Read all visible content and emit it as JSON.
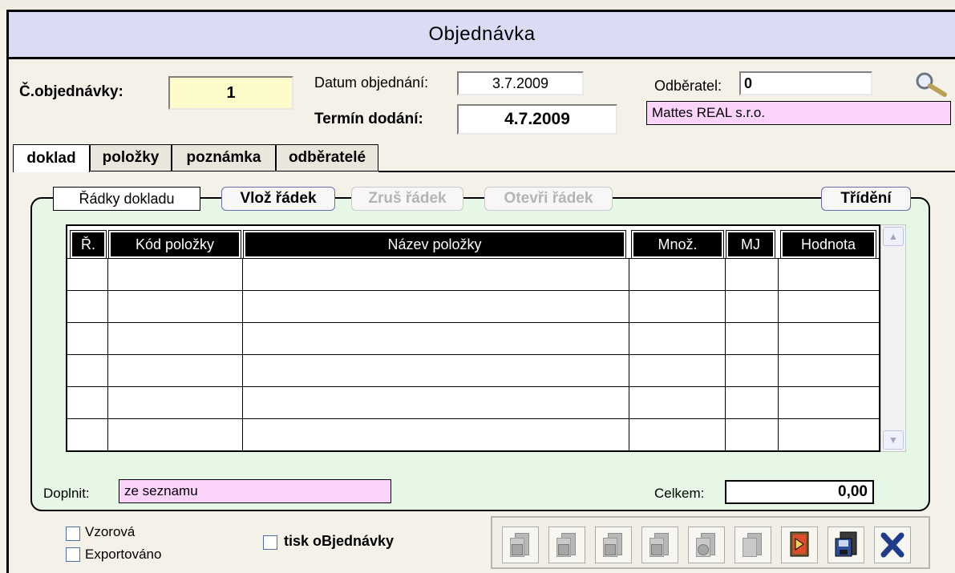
{
  "window": {
    "title": "Objednávka"
  },
  "header": {
    "order_no_label": "Č.objednávky:",
    "order_no_value": "1",
    "order_date_label": "Datum objednání:",
    "order_date_value": "3.7.2009",
    "delivery_label": "Termín dodání:",
    "delivery_value": "4.7.2009",
    "customer_label": "Odběratel:",
    "customer_value": "0",
    "customer_name": "Mattes REAL s.r.o."
  },
  "tabs": [
    {
      "label": "doklad",
      "active": true
    },
    {
      "label": "položky",
      "active": false
    },
    {
      "label": "poznámka",
      "active": false
    },
    {
      "label": "odběratelé",
      "active": false
    }
  ],
  "panel": {
    "title": "Řádky dokladu",
    "insert_row": "Vlož řádek",
    "delete_row": "Zruš řádek",
    "open_row": "Otevři řádek",
    "sort": "Třídění"
  },
  "grid": {
    "columns": [
      "Ř.",
      "Kód položky",
      "Název položky",
      "Množ.",
      "MJ",
      "Hodnota"
    ],
    "rows": []
  },
  "footer": {
    "fill_label": "Doplnit:",
    "fill_value": "ze seznamu",
    "total_label": "Celkem:",
    "total_value": "0,00"
  },
  "checkboxes": {
    "template": "Vzorová",
    "exported": "Exportováno",
    "print": "tisk oBjednávky"
  },
  "colors": {
    "title_bg": "#d9dcf4",
    "panel_bg": "#e6f7e6",
    "order_no_bg": "#fdfbc9",
    "pink_field_bg": "#fbd3fb"
  },
  "toolbar_icons": [
    "doc-icon",
    "doc-icon",
    "doc-icon",
    "doc-icon",
    "doc-icon",
    "doc-icon",
    "export-icon",
    "save-icon",
    "close-icon"
  ]
}
